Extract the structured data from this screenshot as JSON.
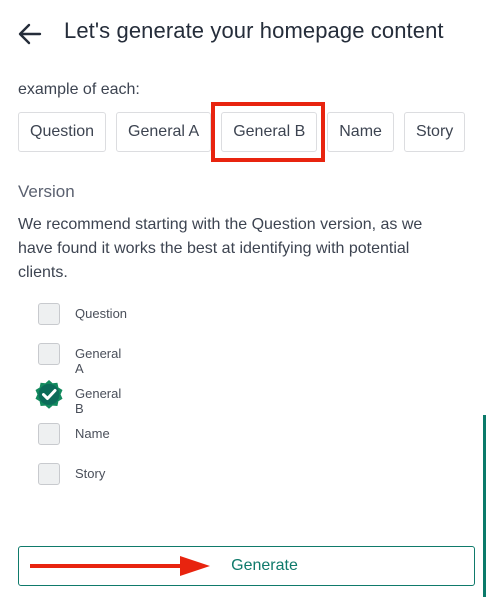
{
  "header": {
    "title": "Let's generate your homepage content",
    "back_icon": "arrow-left-icon"
  },
  "intro_cut": "example of each:",
  "examples": [
    {
      "label": "Question"
    },
    {
      "label": "General A"
    },
    {
      "label": "General B"
    },
    {
      "label": "Name"
    },
    {
      "label": "Story"
    }
  ],
  "version": {
    "heading": "Version",
    "description": "We recommend starting with the Question version, as we have found it works the best at identifying with potential clients.",
    "options": [
      {
        "label": "Question",
        "checked": false
      },
      {
        "label": "General A",
        "checked": false
      },
      {
        "label": "General B",
        "checked": true
      },
      {
        "label": "Name",
        "checked": false
      },
      {
        "label": "Story",
        "checked": false
      }
    ]
  },
  "generate_label": "Generate",
  "colors": {
    "accent": "#0f7a6b",
    "annotation": "#e8240f",
    "check_badge": "#138a5e"
  }
}
